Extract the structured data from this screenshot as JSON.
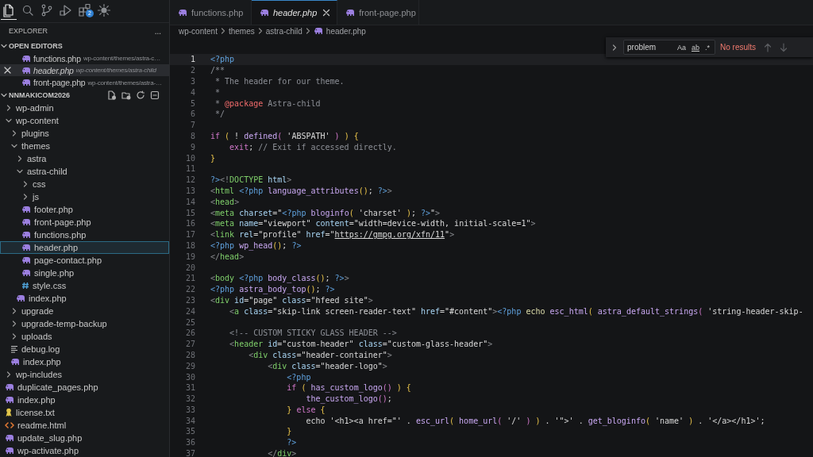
{
  "activity_bar": [
    {
      "kind": "explorer",
      "selected": true
    },
    {
      "kind": "search",
      "selected": false
    },
    {
      "kind": "source-control",
      "selected": false
    },
    {
      "kind": "run",
      "selected": false
    },
    {
      "kind": "extensions",
      "selected": false,
      "badge": "2"
    },
    {
      "kind": "sun",
      "selected": false
    }
  ],
  "explorer": {
    "title": "EXPLORER",
    "more": "...",
    "open_editors": {
      "title": "OPEN EDITORS",
      "expanded": true,
      "items": [
        {
          "kind": "php",
          "name": "functions.php",
          "path": "wp-content/themes/astra-c…",
          "selected": false,
          "preview": false
        },
        {
          "kind": "php",
          "name": "header.php",
          "path": "wp-content/themes/astra-child",
          "selected": true,
          "preview": true
        },
        {
          "kind": "php",
          "name": "front-page.php",
          "path": "wp-content/themes/astra-…",
          "selected": false,
          "preview": false
        }
      ]
    },
    "project": {
      "title": "NNMAKICOM2026",
      "expanded": true,
      "items": [
        {
          "kind": "folder",
          "name": "wp-admin",
          "expanded": false,
          "selected": false
        },
        {
          "kind": "folder",
          "name": "wp-content",
          "expanded": true,
          "selected": false,
          "children": [
            {
              "kind": "folder",
              "name": "plugins",
              "expanded": false,
              "selected": false
            },
            {
              "kind": "folder",
              "name": "themes",
              "expanded": true,
              "selected": false,
              "children": [
                {
                  "kind": "folder",
                  "name": "astra",
                  "expanded": false,
                  "selected": false
                },
                {
                  "kind": "folder",
                  "name": "astra-child",
                  "expanded": true,
                  "selected": false,
                  "children": [
                    {
                      "kind": "folder",
                      "name": "css",
                      "expanded": false,
                      "selected": false
                    },
                    {
                      "kind": "folder",
                      "name": "js",
                      "expanded": false,
                      "selected": false
                    },
                    {
                      "kind": "php",
                      "name": "footer.php",
                      "selected": false
                    },
                    {
                      "kind": "php",
                      "name": "front-page.php",
                      "selected": false
                    },
                    {
                      "kind": "php",
                      "name": "functions.php",
                      "selected": false
                    },
                    {
                      "kind": "php",
                      "name": "header.php",
                      "selected": true
                    },
                    {
                      "kind": "php",
                      "name": "page-contact.php",
                      "selected": false
                    },
                    {
                      "kind": "php",
                      "name": "single.php",
                      "selected": false
                    },
                    {
                      "kind": "css",
                      "name": "style.css",
                      "selected": false
                    }
                  ]
                },
                {
                  "kind": "php",
                  "name": "index.php",
                  "selected": false
                }
              ]
            },
            {
              "kind": "folder",
              "name": "upgrade",
              "expanded": false,
              "selected": false
            },
            {
              "kind": "folder",
              "name": "upgrade-temp-backup",
              "expanded": false,
              "selected": false
            },
            {
              "kind": "folder",
              "name": "uploads",
              "expanded": false,
              "selected": false
            },
            {
              "kind": "log",
              "name": "debug.log",
              "selected": false
            },
            {
              "kind": "php",
              "name": "index.php",
              "selected": false
            }
          ]
        },
        {
          "kind": "folder",
          "name": "wp-includes",
          "expanded": false,
          "selected": false
        },
        {
          "kind": "php",
          "name": "duplicate_pages.php",
          "selected": false
        },
        {
          "kind": "php",
          "name": "index.php",
          "selected": false
        },
        {
          "kind": "license",
          "name": "license.txt",
          "selected": false
        },
        {
          "kind": "html",
          "name": "readme.html",
          "selected": false
        },
        {
          "kind": "php",
          "name": "update_slug.php",
          "selected": false
        },
        {
          "kind": "php",
          "name": "wp-activate.php",
          "selected": false
        }
      ]
    }
  },
  "tabs": [
    {
      "kind": "php",
      "label": "functions.php",
      "selected": false,
      "preview": false
    },
    {
      "kind": "php",
      "label": "header.php",
      "selected": true,
      "preview": true
    },
    {
      "kind": "php",
      "label": "front-page.php",
      "selected": false,
      "preview": false
    }
  ],
  "breadcrumb": [
    "wp-content",
    "themes",
    "astra-child",
    "header.php"
  ],
  "find": {
    "value": "problem",
    "options": [
      {
        "kind": "case",
        "label": "Aa",
        "selected": false
      },
      {
        "kind": "word",
        "label": "ab",
        "selected": false
      },
      {
        "kind": "regex",
        "label": ".*",
        "selected": false
      }
    ],
    "result": "No results"
  },
  "code": [
    {
      "number": "1",
      "current": true,
      "tokens": [
        {
          "kind": "php",
          "text": "<?php"
        }
      ]
    },
    {
      "number": "2",
      "current": false,
      "tokens": [
        {
          "kind": "cmt",
          "text": "/**"
        }
      ]
    },
    {
      "number": "3",
      "current": false,
      "tokens": [
        {
          "kind": "cmt",
          "text": " * The header for our theme."
        }
      ]
    },
    {
      "number": "4",
      "current": false,
      "tokens": [
        {
          "kind": "cmt",
          "text": " *"
        }
      ]
    },
    {
      "number": "5",
      "current": false,
      "tokens": [
        {
          "kind": "cmt",
          "text": " * "
        },
        {
          "kind": "doctag",
          "text": "@package"
        },
        {
          "kind": "cmt",
          "text": " Astra-child"
        }
      ]
    },
    {
      "number": "6",
      "current": false,
      "tokens": [
        {
          "kind": "cmt",
          "text": " */"
        }
      ]
    },
    {
      "number": "7",
      "current": false
    },
    {
      "number": "8",
      "current": false,
      "tokens": [
        {
          "kind": "kw",
          "text": "if"
        },
        {
          "kind": "paren",
          "text": " ("
        },
        {
          "kind": "plain",
          "text": " ! "
        },
        {
          "kind": "fn",
          "text": "defined"
        },
        {
          "kind": "paren2",
          "text": "("
        },
        {
          "kind": "str",
          "text": " 'ABSPATH'"
        },
        {
          "kind": "paren2",
          "text": " )"
        },
        {
          "kind": "paren",
          "text": " ) {"
        }
      ]
    },
    {
      "number": "9",
      "current": false,
      "tokens": [
        {
          "kind": "kw",
          "text": "    exit"
        },
        {
          "kind": "plain",
          "text": "; "
        },
        {
          "kind": "cmt",
          "text": "// Exit if accessed directly."
        }
      ]
    },
    {
      "number": "10",
      "current": false,
      "tokens": [
        {
          "kind": "paren",
          "text": "}"
        }
      ]
    },
    {
      "number": "11",
      "current": false
    },
    {
      "number": "12",
      "current": false,
      "tokens": [
        {
          "kind": "php",
          "text": "?>"
        },
        {
          "kind": "br",
          "text": "<!"
        },
        {
          "kind": "tag",
          "text": "DOCTYPE"
        },
        {
          "kind": "attr",
          "text": " html"
        },
        {
          "kind": "br",
          "text": ">"
        }
      ]
    },
    {
      "number": "13",
      "current": false,
      "tokens": [
        {
          "kind": "br",
          "text": "<"
        },
        {
          "kind": "tag",
          "text": "html"
        },
        {
          "kind": "php",
          "text": " <?php"
        },
        {
          "kind": "fn",
          "text": " language_attributes"
        },
        {
          "kind": "paren",
          "text": "()"
        },
        {
          "kind": "plain",
          "text": "; "
        },
        {
          "kind": "php",
          "text": "?>"
        },
        {
          "kind": "br",
          "text": ">"
        }
      ]
    },
    {
      "number": "14",
      "current": false,
      "tokens": [
        {
          "kind": "br",
          "text": "<"
        },
        {
          "kind": "tag",
          "text": "head"
        },
        {
          "kind": "br",
          "text": ">"
        }
      ]
    },
    {
      "number": "15",
      "current": false,
      "tokens": [
        {
          "kind": "br",
          "text": "<"
        },
        {
          "kind": "tag",
          "text": "meta"
        },
        {
          "kind": "attr",
          "text": " charset"
        },
        {
          "kind": "plain",
          "text": "="
        },
        {
          "kind": "str",
          "text": "\""
        },
        {
          "kind": "php",
          "text": "<?php"
        },
        {
          "kind": "fn",
          "text": " bloginfo"
        },
        {
          "kind": "paren",
          "text": "("
        },
        {
          "kind": "str",
          "text": " 'charset'"
        },
        {
          "kind": "paren",
          "text": " )"
        },
        {
          "kind": "plain",
          "text": "; "
        },
        {
          "kind": "php",
          "text": "?>"
        },
        {
          "kind": "str",
          "text": "\""
        },
        {
          "kind": "br",
          "text": ">"
        }
      ]
    },
    {
      "number": "16",
      "current": false,
      "tokens": [
        {
          "kind": "br",
          "text": "<"
        },
        {
          "kind": "tag",
          "text": "meta"
        },
        {
          "kind": "attr",
          "text": " name"
        },
        {
          "kind": "plain",
          "text": "="
        },
        {
          "kind": "str",
          "text": "\"viewport\""
        },
        {
          "kind": "attr",
          "text": " content"
        },
        {
          "kind": "plain",
          "text": "="
        },
        {
          "kind": "str",
          "text": "\"width=device-width, initial-scale=1\""
        },
        {
          "kind": "br",
          "text": ">"
        }
      ]
    },
    {
      "number": "17",
      "current": false,
      "tokens": [
        {
          "kind": "br",
          "text": "<"
        },
        {
          "kind": "tag",
          "text": "link"
        },
        {
          "kind": "attr",
          "text": " rel"
        },
        {
          "kind": "plain",
          "text": "="
        },
        {
          "kind": "str",
          "text": "\"profile\""
        },
        {
          "kind": "attr",
          "text": " href"
        },
        {
          "kind": "plain",
          "text": "="
        },
        {
          "kind": "str",
          "text": "\""
        },
        {
          "kind": "url",
          "text": "https://gmpg.org/xfn/11"
        },
        {
          "kind": "str",
          "text": "\""
        },
        {
          "kind": "br",
          "text": ">"
        }
      ]
    },
    {
      "number": "18",
      "current": false,
      "tokens": [
        {
          "kind": "php",
          "text": "<?php"
        },
        {
          "kind": "fn",
          "text": " wp_head"
        },
        {
          "kind": "paren",
          "text": "()"
        },
        {
          "kind": "plain",
          "text": "; "
        },
        {
          "kind": "php",
          "text": "?>"
        }
      ]
    },
    {
      "number": "19",
      "current": false,
      "tokens": [
        {
          "kind": "br",
          "text": "</"
        },
        {
          "kind": "tag",
          "text": "head"
        },
        {
          "kind": "br",
          "text": ">"
        }
      ]
    },
    {
      "number": "20",
      "current": false
    },
    {
      "number": "21",
      "current": false,
      "tokens": [
        {
          "kind": "br",
          "text": "<"
        },
        {
          "kind": "tag",
          "text": "body"
        },
        {
          "kind": "php",
          "text": " <?php"
        },
        {
          "kind": "fn",
          "text": " body_class"
        },
        {
          "kind": "paren",
          "text": "()"
        },
        {
          "kind": "plain",
          "text": "; "
        },
        {
          "kind": "php",
          "text": "?>"
        },
        {
          "kind": "br",
          "text": ">"
        }
      ]
    },
    {
      "number": "22",
      "current": false,
      "tokens": [
        {
          "kind": "php",
          "text": "<?php"
        },
        {
          "kind": "fn",
          "text": " astra_body_top"
        },
        {
          "kind": "paren",
          "text": "()"
        },
        {
          "kind": "plain",
          "text": "; "
        },
        {
          "kind": "php",
          "text": "?>"
        }
      ]
    },
    {
      "number": "23",
      "current": false,
      "tokens": [
        {
          "kind": "br",
          "text": "<"
        },
        {
          "kind": "tag",
          "text": "div"
        },
        {
          "kind": "attr",
          "text": " id"
        },
        {
          "kind": "plain",
          "text": "="
        },
        {
          "kind": "str",
          "text": "\"page\""
        },
        {
          "kind": "attr",
          "text": " class"
        },
        {
          "kind": "plain",
          "text": "="
        },
        {
          "kind": "str",
          "text": "\"hfeed site\""
        },
        {
          "kind": "br",
          "text": ">"
        }
      ]
    },
    {
      "number": "24",
      "current": false,
      "tokens": [
        {
          "kind": "br",
          "text": "    <"
        },
        {
          "kind": "tag",
          "text": "a"
        },
        {
          "kind": "attr",
          "text": " class"
        },
        {
          "kind": "plain",
          "text": "="
        },
        {
          "kind": "str",
          "text": "\"skip-link screen-reader-text\""
        },
        {
          "kind": "attr",
          "text": " href"
        },
        {
          "kind": "plain",
          "text": "="
        },
        {
          "kind": "str",
          "text": "\"#content\""
        },
        {
          "kind": "br",
          "text": ">"
        },
        {
          "kind": "php",
          "text": "<?php"
        },
        {
          "kind": "echo",
          "text": " echo"
        },
        {
          "kind": "fn",
          "text": " esc_html"
        },
        {
          "kind": "paren",
          "text": "("
        },
        {
          "kind": "fn",
          "text": " astra_default_strings"
        },
        {
          "kind": "paren2",
          "text": "("
        },
        {
          "kind": "str",
          "text": " 'string-header-skip-"
        }
      ]
    },
    {
      "number": "25",
      "current": false
    },
    {
      "number": "26",
      "current": false,
      "tokens": [
        {
          "kind": "cmt",
          "text": "    <!-- CUSTOM STICKY GLASS HEADER -->"
        }
      ]
    },
    {
      "number": "27",
      "current": false,
      "tokens": [
        {
          "kind": "br",
          "text": "    <"
        },
        {
          "kind": "tag",
          "text": "header"
        },
        {
          "kind": "attr",
          "text": " id"
        },
        {
          "kind": "plain",
          "text": "="
        },
        {
          "kind": "str",
          "text": "\"custom-header\""
        },
        {
          "kind": "attr",
          "text": " class"
        },
        {
          "kind": "plain",
          "text": "="
        },
        {
          "kind": "str",
          "text": "\"custom-glass-header\""
        },
        {
          "kind": "br",
          "text": ">"
        }
      ]
    },
    {
      "number": "28",
      "current": false,
      "tokens": [
        {
          "kind": "br",
          "text": "        <"
        },
        {
          "kind": "tag",
          "text": "div"
        },
        {
          "kind": "attr",
          "text": " class"
        },
        {
          "kind": "plain",
          "text": "="
        },
        {
          "kind": "str",
          "text": "\"header-container\""
        },
        {
          "kind": "br",
          "text": ">"
        }
      ]
    },
    {
      "number": "29",
      "current": false,
      "tokens": [
        {
          "kind": "br",
          "text": "            <"
        },
        {
          "kind": "tag",
          "text": "div"
        },
        {
          "kind": "attr",
          "text": " class"
        },
        {
          "kind": "plain",
          "text": "="
        },
        {
          "kind": "str",
          "text": "\"header-logo\""
        },
        {
          "kind": "br",
          "text": ">"
        }
      ]
    },
    {
      "number": "30",
      "current": false,
      "tokens": [
        {
          "kind": "php",
          "text": "                <?php"
        }
      ]
    },
    {
      "number": "31",
      "current": false,
      "tokens": [
        {
          "kind": "kw",
          "text": "                if"
        },
        {
          "kind": "paren",
          "text": " ("
        },
        {
          "kind": "fn",
          "text": " has_custom_logo"
        },
        {
          "kind": "paren2",
          "text": "()"
        },
        {
          "kind": "paren",
          "text": " ) {"
        }
      ]
    },
    {
      "number": "32",
      "current": false,
      "tokens": [
        {
          "kind": "fn",
          "text": "                    the_custom_logo"
        },
        {
          "kind": "paren2",
          "text": "()"
        },
        {
          "kind": "plain",
          "text": ";"
        }
      ]
    },
    {
      "number": "33",
      "current": false,
      "tokens": [
        {
          "kind": "paren",
          "text": "                }"
        },
        {
          "kind": "kw",
          "text": " else"
        },
        {
          "kind": "paren",
          "text": " {"
        }
      ]
    },
    {
      "number": "34",
      "current": false,
      "tokens": [
        {
          "kind": "plain",
          "text": "                    echo "
        },
        {
          "kind": "str",
          "text": "'<h1><a href=\"'"
        },
        {
          "kind": "plain",
          "text": " . "
        },
        {
          "kind": "fn",
          "text": "esc_url"
        },
        {
          "kind": "paren",
          "text": "("
        },
        {
          "kind": "fn",
          "text": " home_url"
        },
        {
          "kind": "paren2",
          "text": "("
        },
        {
          "kind": "str",
          "text": " '/'"
        },
        {
          "kind": "paren2",
          "text": " )"
        },
        {
          "kind": "paren",
          "text": " )"
        },
        {
          "kind": "plain",
          "text": " . "
        },
        {
          "kind": "str",
          "text": "'\">'"
        },
        {
          "kind": "plain",
          "text": " . "
        },
        {
          "kind": "fn",
          "text": "get_bloginfo"
        },
        {
          "kind": "paren",
          "text": "("
        },
        {
          "kind": "str",
          "text": " 'name'"
        },
        {
          "kind": "paren",
          "text": " )"
        },
        {
          "kind": "plain",
          "text": " . "
        },
        {
          "kind": "str",
          "text": "'</a></h1>'"
        },
        {
          "kind": "plain",
          "text": ";"
        }
      ]
    },
    {
      "number": "35",
      "current": false,
      "tokens": [
        {
          "kind": "paren",
          "text": "                }"
        }
      ]
    },
    {
      "number": "36",
      "current": false,
      "tokens": [
        {
          "kind": "php",
          "text": "                ?>"
        }
      ]
    },
    {
      "number": "37",
      "current": false,
      "tokens": [
        {
          "kind": "br",
          "text": "            </"
        },
        {
          "kind": "tag",
          "text": "div"
        },
        {
          "kind": "br",
          "text": ">"
        }
      ]
    }
  ]
}
